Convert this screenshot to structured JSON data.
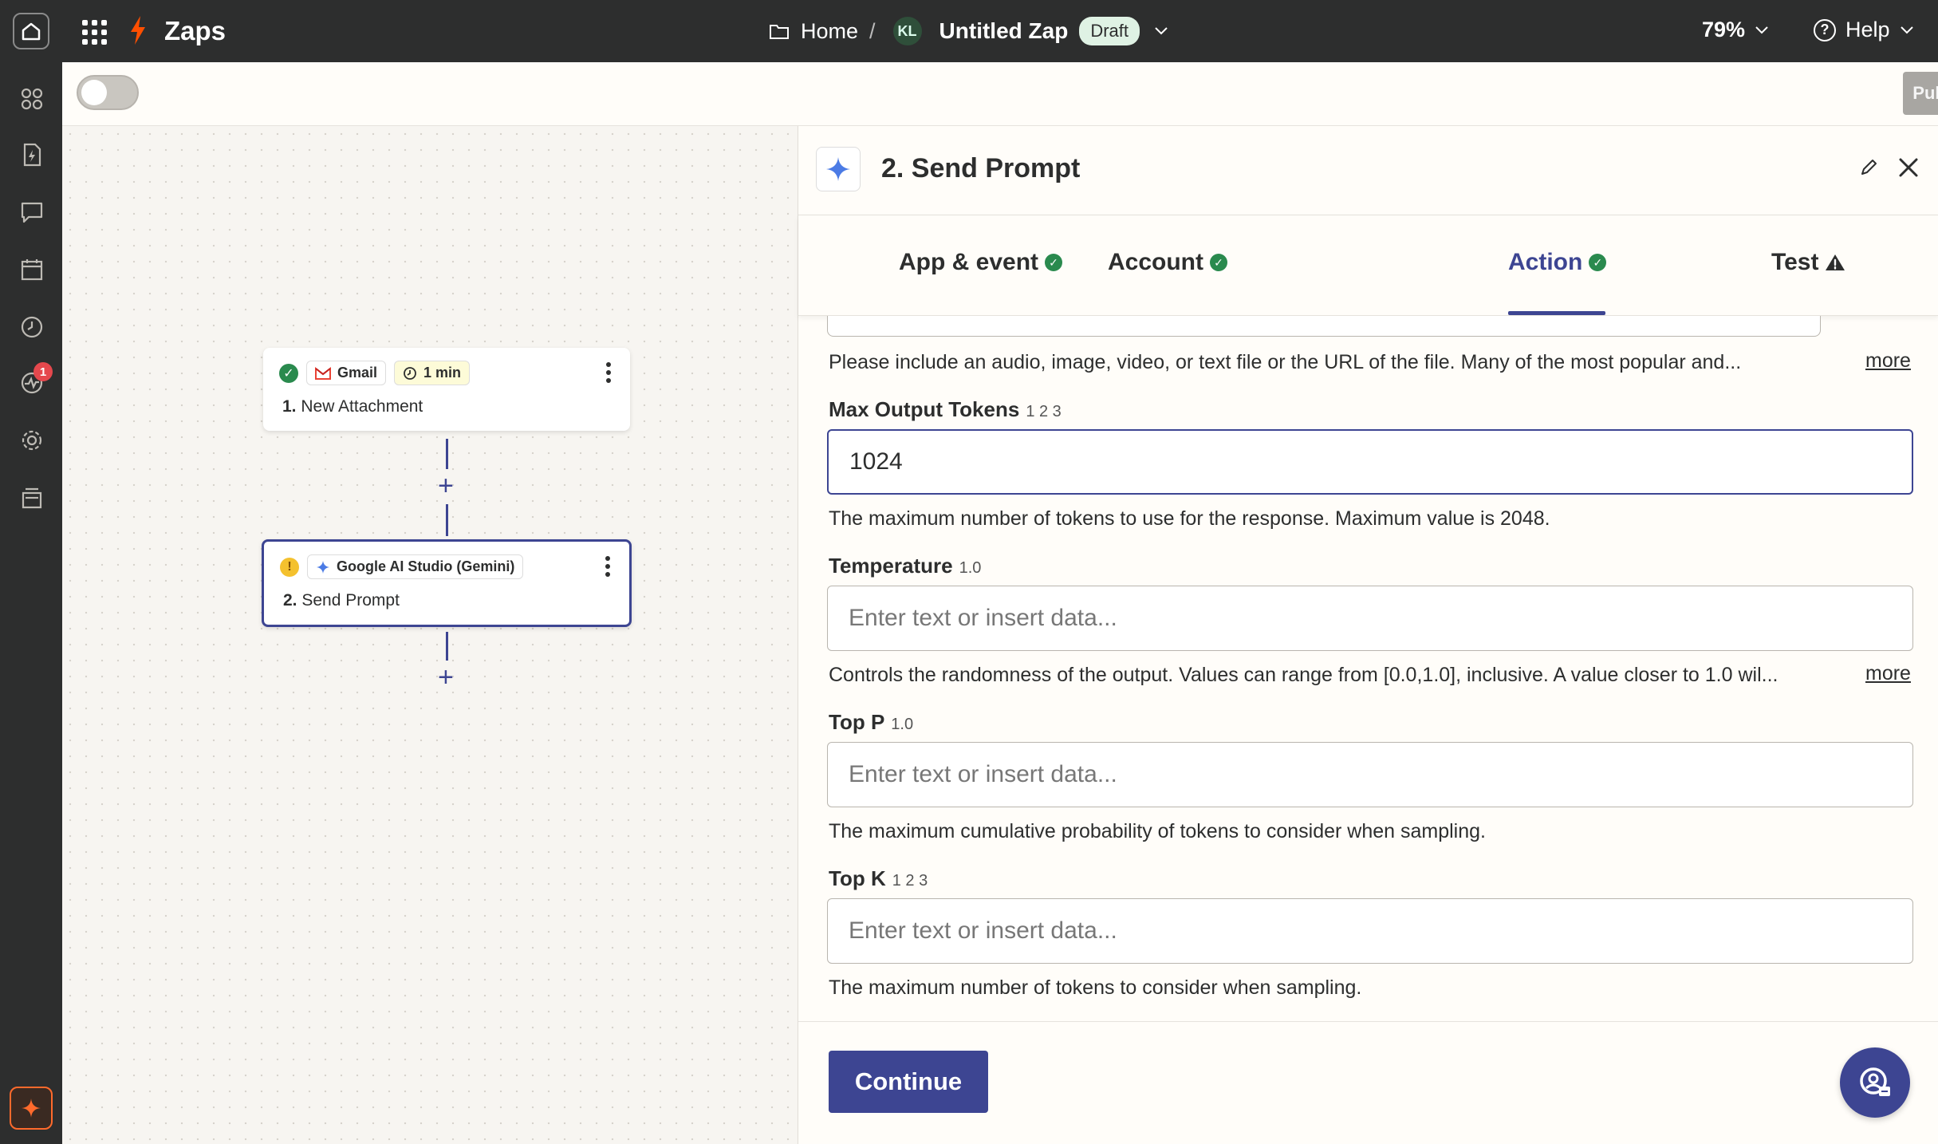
{
  "topbar": {
    "brand": "Zaps",
    "breadcrumb_home": "Home",
    "breadcrumb_sep": "/",
    "owner_initials": "KL",
    "zap_name": "Untitled Zap",
    "zap_status": "Draft",
    "zoom": "79%",
    "help_label": "Help"
  },
  "rail": {
    "notification_count": "1"
  },
  "subbar": {
    "publish_label": "Publish"
  },
  "canvas": {
    "steps": [
      {
        "app": "Gmail",
        "time": "1 min",
        "number": "1.",
        "name": "New Attachment",
        "status": "ok"
      },
      {
        "app": "Google AI Studio (Gemini)",
        "number": "2.",
        "name": "Send Prompt",
        "status": "warning"
      }
    ],
    "add_symbol": "+"
  },
  "panel": {
    "title": "2. Send Prompt",
    "tabs": [
      {
        "label": "App & event",
        "state": "complete"
      },
      {
        "label": "Account",
        "state": "complete"
      },
      {
        "label": "Action",
        "state": "complete",
        "active": true
      },
      {
        "label": "Test",
        "state": "warning"
      }
    ],
    "file_help": "Please include an audio, image, video, or text file or the URL of the file. Many of the most popular and...",
    "more_label": "more",
    "fields": [
      {
        "label": "Max Output Tokens",
        "hint": "1 2 3",
        "value": "1024",
        "placeholder": "",
        "help": "The maximum number of tokens to use for the response. Maximum value is 2048."
      },
      {
        "label": "Temperature",
        "hint": "1.0",
        "value": "",
        "placeholder": "Enter text or insert data...",
        "help": "Controls the randomness of the output. Values can range from [0.0,1.0], inclusive. A value closer to 1.0 wil..."
      },
      {
        "label": "Top P",
        "hint": "1.0",
        "value": "",
        "placeholder": "Enter text or insert data...",
        "help": "The maximum cumulative probability of tokens to consider when sampling."
      },
      {
        "label": "Top K",
        "hint": "1 2 3",
        "value": "",
        "placeholder": "Enter text or insert data...",
        "help": "The maximum number of tokens to consider when sampling."
      }
    ],
    "continue_label": "Continue"
  },
  "colors": {
    "accent": "#3d4592",
    "brand_orange": "#ff4f00",
    "success": "#2a8a4e",
    "warning": "#f4c12e",
    "dark_chrome": "#2d2e2e"
  },
  "icons": {
    "home": "home-icon",
    "apps": "grid-icon",
    "brand": "bolt-icon",
    "folder": "folder-icon",
    "chevron": "chevron-down-icon",
    "help": "question-circle-icon",
    "edit": "pencil-icon",
    "close": "close-icon",
    "gemini": "sparkle-icon",
    "gmail": "gmail-icon"
  }
}
